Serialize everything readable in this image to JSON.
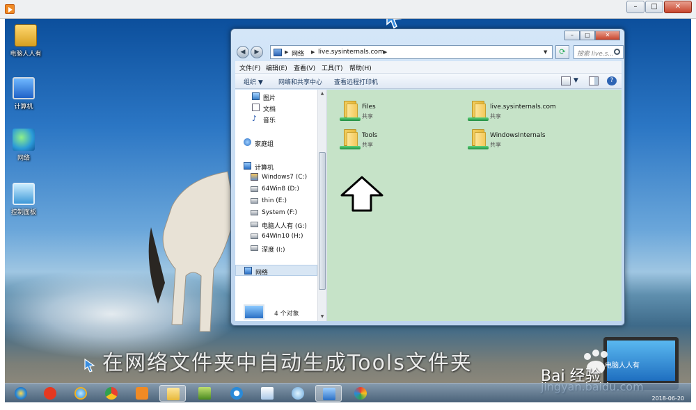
{
  "window": {
    "minimize": "–",
    "maximize": "□",
    "close": "✕"
  },
  "desktop_icons": [
    {
      "label": "电脑人人有",
      "icon": "user-folder-icon"
    },
    {
      "label": "计算机",
      "icon": "computer-icon"
    },
    {
      "label": "网络",
      "icon": "network-icon"
    },
    {
      "label": "控制面板",
      "icon": "control-panel-icon"
    }
  ],
  "explorer": {
    "title_controls": {
      "minimize": "–",
      "maximize": "□",
      "close": "✕"
    },
    "breadcrumb": [
      "网络",
      "live.sysinternals.com"
    ],
    "search_placeholder": "搜索 live.s...",
    "menu": [
      "文件(F)",
      "编辑(E)",
      "查看(V)",
      "工具(T)",
      "帮助(H)"
    ],
    "commands": {
      "organize": "组织 ▼",
      "network_center": "网络和共享中心",
      "remote_printers": "查看远程打印机"
    },
    "nav_pane": {
      "libraries": [
        "图片",
        "文档",
        "音乐"
      ],
      "homegroup": "家庭组",
      "computer": "计算机",
      "drives": [
        "Windows7 (C:)",
        "64Win8  (D:)",
        "thin (E:)",
        "System (F:)",
        "电脑人人有 (G:)",
        "64Win10 (H:)",
        "深度 (I:)"
      ],
      "network": "网络"
    },
    "items": [
      {
        "name": "Files",
        "sub": "共享"
      },
      {
        "name": "live.sysinternals.com",
        "sub": "共享"
      },
      {
        "name": "Tools",
        "sub": "共享"
      },
      {
        "name": "WindowsInternals",
        "sub": "共享"
      }
    ],
    "status": "4 个对象"
  },
  "caption": "在网络文件夹中自动生成Tools文件夹",
  "watermark": {
    "url": "jingyan.baidu.com",
    "laptop_text": "电脑人人有",
    "date": "2018-06-20",
    "brand": "Bai 经验"
  },
  "colors": {
    "content_bg": "#c6e3c8",
    "desktop_top": "#0c4f9c",
    "accent": "#2d64b4"
  }
}
